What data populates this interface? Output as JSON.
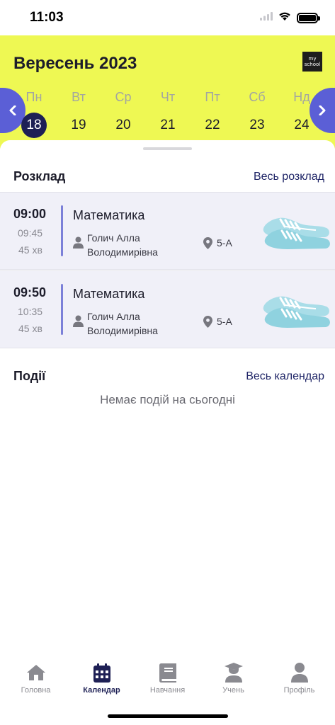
{
  "status": {
    "time": "11:03"
  },
  "calendar": {
    "month_title": "Вересень 2023",
    "logo_text": "my school",
    "prev_icon": "chevron-left-icon",
    "next_icon": "chevron-right-icon",
    "days": [
      {
        "name": "Пн",
        "num": "18",
        "selected": true
      },
      {
        "name": "Вт",
        "num": "19"
      },
      {
        "name": "Ср",
        "num": "20"
      },
      {
        "name": "Чт",
        "num": "21"
      },
      {
        "name": "Пт",
        "num": "22"
      },
      {
        "name": "Сб",
        "num": "23"
      },
      {
        "name": "Нд",
        "num": "24"
      }
    ],
    "header_color": "#eef853",
    "nav_color": "#5b5fd6",
    "selected_color": "#1e2055"
  },
  "schedule": {
    "title": "Розклад",
    "link": "Весь розклад",
    "lessons": [
      {
        "start": "09:00",
        "end": "09:45",
        "duration": "45 хв",
        "subject": "Математика",
        "teacher_line1": "Голич Алла",
        "teacher_line2": "Володимирівна",
        "room": "5-А",
        "icon": "sneakers-icon"
      },
      {
        "start": "09:50",
        "end": "10:35",
        "duration": "45 хв",
        "subject": "Математика",
        "teacher_line1": "Голич Алла",
        "teacher_line2": "Володимирівна",
        "room": "5-А",
        "icon": "sneakers-icon"
      }
    ]
  },
  "events": {
    "title": "Події",
    "link": "Весь календар",
    "empty_text": "Немає подій на сьогодні"
  },
  "tabbar": {
    "items": [
      {
        "label": "Головна",
        "icon": "home-icon"
      },
      {
        "label": "Календар",
        "icon": "calendar-icon",
        "active": true
      },
      {
        "label": "Навчання",
        "icon": "book-icon"
      },
      {
        "label": "Учень",
        "icon": "student-icon"
      },
      {
        "label": "Профіль",
        "icon": "user-icon"
      }
    ]
  }
}
